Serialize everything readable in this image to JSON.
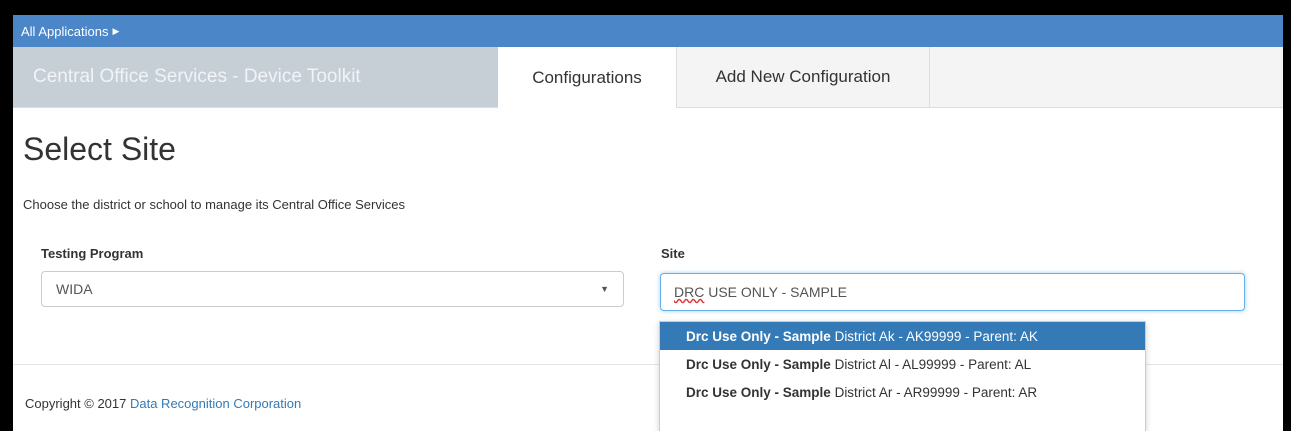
{
  "topbar": {
    "label": "All Applications",
    "caret": "▶"
  },
  "header": {
    "brand": "Central Office Services - Device Toolkit",
    "tabs": [
      {
        "label": "Configurations",
        "active": true
      },
      {
        "label": "Add New Configuration",
        "active": false
      }
    ]
  },
  "main": {
    "title": "Select Site",
    "subtitle": "Choose the district or school to manage its Central Office Services",
    "testing_program": {
      "label": "Testing Program",
      "value": "WIDA",
      "arrow": "▼"
    },
    "site": {
      "label": "Site",
      "value_prefix": "DRC",
      "value_rest": " USE ONLY - SAMPLE"
    },
    "dropdown": [
      {
        "bold": "Drc Use Only - Sample",
        "rest": " District Ak - AK99999 - Parent: AK",
        "selected": true
      },
      {
        "bold": "Drc Use Only - Sample",
        "rest": " District Al - AL99999 - Parent: AL",
        "selected": false
      },
      {
        "bold": "Drc Use Only - Sample",
        "rest": " District Ar - AR99999 - Parent: AR",
        "selected": false
      }
    ]
  },
  "footer": {
    "copyright": "Copyright © 2017 ",
    "link": "Data Recognition Corporation"
  },
  "colors": {
    "topbar": "#4a86c8",
    "selected": "#337ab7",
    "brand_bg": "#c6ced6"
  }
}
